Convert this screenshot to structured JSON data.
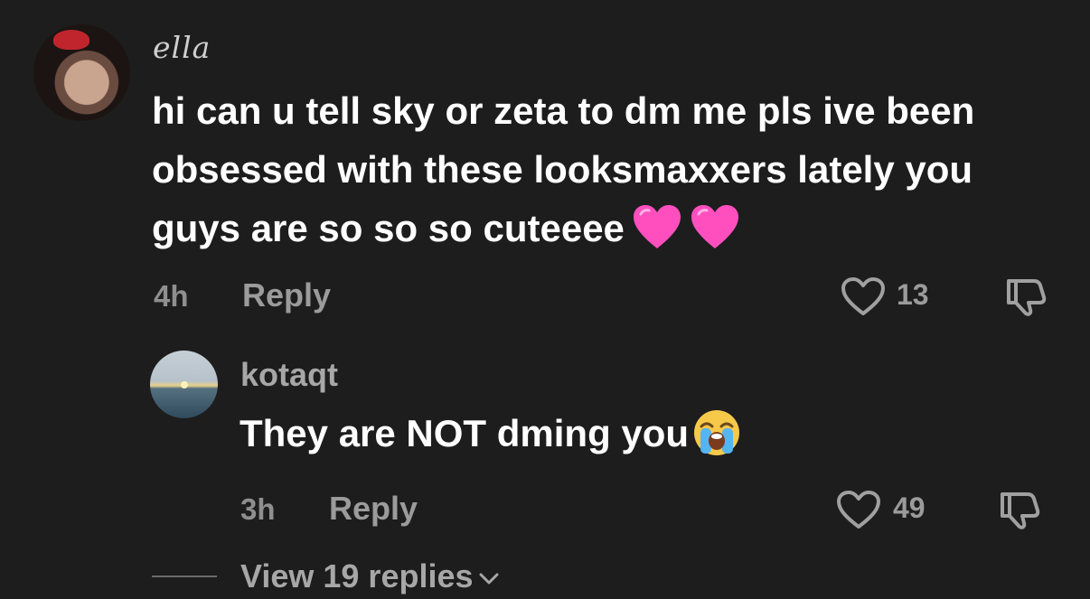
{
  "comment": {
    "username": "ella",
    "text": "hi can u tell sky or zeta to dm me pls ive been obsessed with these looksmaxxers lately you guys are so so so cuteeee",
    "emoji": [
      "pink-heart",
      "pink-heart"
    ],
    "time": "4h",
    "reply_label": "Reply",
    "likes": "13"
  },
  "reply": {
    "username": "kotaqt",
    "text": "They are NOT dming you",
    "emoji": "loudly-crying-face",
    "time": "3h",
    "reply_label": "Reply",
    "likes": "49"
  },
  "view_replies_label": "View 19 replies",
  "colors": {
    "background": "#1d1d1d",
    "text_primary": "#ffffff",
    "text_secondary": "#9b9b9b",
    "heart_emoji": "#ff4fbf"
  }
}
